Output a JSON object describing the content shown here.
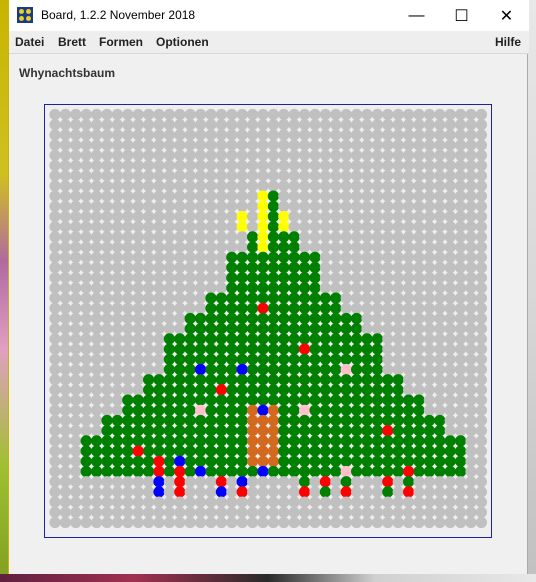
{
  "window": {
    "title": "Board, 1.2.2 November 2018",
    "controls": {
      "minimize": "—",
      "maximize": "☐",
      "close": "✕"
    }
  },
  "menu": {
    "items": [
      "Datei",
      "Brett",
      "Formen",
      "Optionen"
    ],
    "help": "Hilfe"
  },
  "board": {
    "title": "Whynachtsbaum",
    "cols": 21,
    "rows": 21,
    "colors": {
      "background": "#c0c0c0",
      "tree": "#008000",
      "star": "#ffff00",
      "trunk": "#d2691e",
      "ornament_red": "#ff0000",
      "ornament_blue": "#0000ff",
      "ornament_pink": "#ffc0cb"
    },
    "tree_rows": [
      {
        "row": 5,
        "from": 10,
        "to": 10
      },
      {
        "row": 6,
        "from": 10,
        "to": 10
      },
      {
        "row": 7,
        "from": 9,
        "to": 11
      },
      {
        "row": 8,
        "from": 8,
        "to": 12
      },
      {
        "row": 9,
        "from": 8,
        "to": 12
      },
      {
        "row": 10,
        "from": 7,
        "to": 13
      },
      {
        "row": 11,
        "from": 6,
        "to": 14
      },
      {
        "row": 12,
        "from": 5,
        "to": 15
      },
      {
        "row": 13,
        "from": 5,
        "to": 15
      },
      {
        "row": 14,
        "from": 4,
        "to": 16
      },
      {
        "row": 15,
        "from": 3,
        "to": 17
      },
      {
        "row": 16,
        "from": 2,
        "to": 18
      },
      {
        "row": 17,
        "from": 1,
        "to": 19
      },
      {
        "row": 18,
        "from": 1,
        "to": 19
      }
    ],
    "star_cells": [
      [
        4,
        10
      ],
      [
        5,
        10
      ],
      [
        5,
        9
      ],
      [
        5,
        11
      ],
      [
        6,
        10
      ]
    ],
    "trunk_cells": [
      [
        19,
        10
      ],
      [
        19,
        11
      ],
      [
        20,
        10
      ],
      [
        20,
        11
      ],
      [
        21,
        10
      ],
      [
        21,
        11
      ],
      [
        22,
        10
      ],
      [
        22,
        11
      ],
      [
        23,
        10
      ],
      [
        23,
        11
      ],
      [
        24,
        10
      ],
      [
        24,
        11
      ]
    ],
    "ornaments": [
      {
        "row": 10,
        "col": 10,
        "color": "red"
      },
      {
        "row": 12,
        "col": 12,
        "color": "red"
      },
      {
        "row": 13,
        "col": 7,
        "color": "blue"
      },
      {
        "row": 13,
        "col": 9,
        "color": "blue"
      },
      {
        "row": 13,
        "col": 14,
        "color": "pink"
      },
      {
        "row": 14,
        "col": 8,
        "color": "red"
      },
      {
        "row": 15,
        "col": 7,
        "color": "pink"
      },
      {
        "row": 15,
        "col": 10,
        "color": "blue"
      },
      {
        "row": 15,
        "col": 12,
        "color": "pink"
      },
      {
        "row": 16,
        "col": 16,
        "color": "red"
      },
      {
        "row": 17,
        "col": 4,
        "color": "red"
      },
      {
        "row": 18,
        "col": 7,
        "color": "blue"
      },
      {
        "row": 18,
        "col": 10,
        "color": "blue"
      },
      {
        "row": 18,
        "col": 14,
        "color": "pink"
      },
      {
        "row": 18,
        "col": 17,
        "color": "red"
      }
    ],
    "gifts": [
      {
        "row": 22,
        "col": 5,
        "color": "red"
      },
      {
        "row": 22,
        "col": 6,
        "color": "blue"
      },
      {
        "row": 23,
        "col": 5,
        "color": "red"
      },
      {
        "row": 23,
        "col": 6,
        "color": "red"
      },
      {
        "row": 24,
        "col": 5,
        "color": "blue"
      },
      {
        "row": 24,
        "col": 6,
        "color": "red"
      },
      {
        "row": 25,
        "col": 5,
        "color": "blue"
      },
      {
        "row": 25,
        "col": 6,
        "color": "red"
      },
      {
        "row": 24,
        "col": 8,
        "color": "red"
      },
      {
        "row": 24,
        "col": 9,
        "color": "blue"
      },
      {
        "row": 25,
        "col": 8,
        "color": "blue"
      },
      {
        "row": 25,
        "col": 9,
        "color": "red"
      },
      {
        "row": 24,
        "col": 12,
        "color": "green"
      },
      {
        "row": 24,
        "col": 13,
        "color": "red"
      },
      {
        "row": 24,
        "col": 14,
        "color": "green"
      },
      {
        "row": 25,
        "col": 12,
        "color": "red"
      },
      {
        "row": 25,
        "col": 13,
        "color": "green"
      },
      {
        "row": 25,
        "col": 14,
        "color": "red"
      },
      {
        "row": 24,
        "col": 16,
        "color": "red"
      },
      {
        "row": 24,
        "col": 17,
        "color": "green"
      },
      {
        "row": 25,
        "col": 16,
        "color": "green"
      },
      {
        "row": 25,
        "col": 17,
        "color": "red"
      }
    ]
  }
}
